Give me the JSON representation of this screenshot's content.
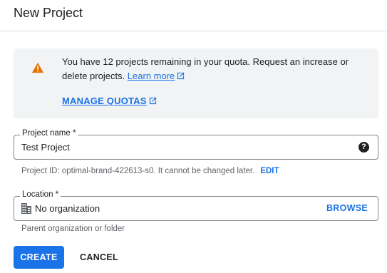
{
  "dialog": {
    "title": "New Project"
  },
  "quota": {
    "message": "You have 12 projects remaining in your quota. Request an increase or delete projects.",
    "learn_more_label": "Learn more",
    "manage_quotas_label": "MANAGE QUOTAS",
    "icon": "warning-icon",
    "icon_color": "#e37400"
  },
  "project_name": {
    "label": "Project name *",
    "value": "Test Project",
    "help_icon": "?",
    "hint_prefix": "Project ID: optimal-brand-422613-s0. It cannot be changed later.",
    "edit_label": "EDIT"
  },
  "location": {
    "label": "Location *",
    "value": "No organization",
    "browse_label": "BROWSE",
    "hint": "Parent organization or folder",
    "icon": "organization-icon"
  },
  "actions": {
    "create_label": "CREATE",
    "cancel_label": "CANCEL"
  },
  "colors": {
    "accent": "#1a73e8",
    "quota_background": "#f1f3f4"
  }
}
